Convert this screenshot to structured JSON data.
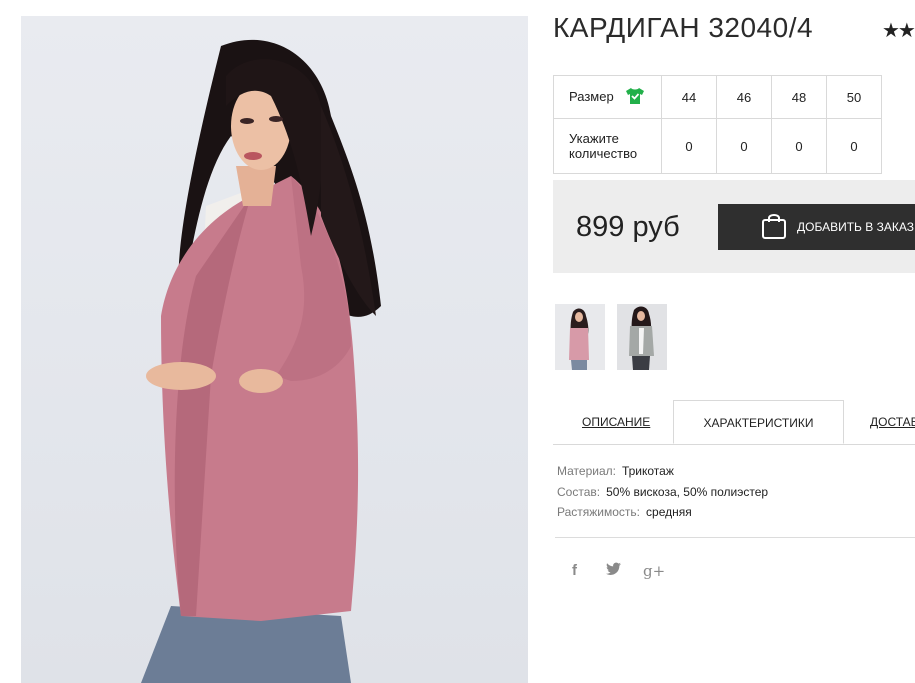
{
  "product": {
    "title": "КАРДИГАН 32040/4",
    "rating_stars": "★★"
  },
  "sizes": {
    "size_label": "Размер",
    "qty_label": "Укажите количество",
    "columns": [
      "44",
      "46",
      "48",
      "50"
    ],
    "quantities": [
      "0",
      "0",
      "0",
      "0"
    ]
  },
  "purchase": {
    "price": "899 руб",
    "add_button_label": "ДОБАВИТЬ В ЗАКАЗ"
  },
  "tabs": {
    "description": "ОПИСАНИЕ",
    "characteristics": "ХАРАКТЕРИСТИКИ",
    "delivery": "ДОСТАВКА"
  },
  "specs": [
    {
      "label": "Материал:",
      "value": "Трикотаж"
    },
    {
      "label": "Состав:",
      "value": "50% вискоза, 50% полиэстер"
    },
    {
      "label": "Растяжимость:",
      "value": "средняя"
    }
  ],
  "social": {
    "facebook": "f",
    "twitter": "🐦",
    "googleplus": "g+"
  },
  "colors": {
    "cardigan": "#c77b8c",
    "button_bg": "#2f2f2f",
    "price_bg": "#ededed",
    "size_icon": "#22b04a"
  }
}
